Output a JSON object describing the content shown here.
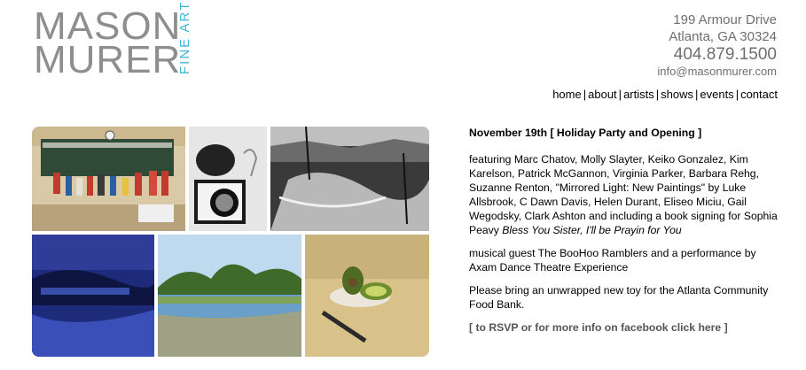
{
  "logo": {
    "line1": "MASON",
    "line2": "MURER",
    "subtitle": "FINE ART"
  },
  "address": {
    "street": "199 Armour Drive",
    "city": "Atlanta, GA 30324",
    "phone": "404.879.1500",
    "email": "info@masonmurer.com"
  },
  "nav": {
    "items": [
      "home",
      "about",
      "artists",
      "shows",
      "events",
      "contact"
    ]
  },
  "event": {
    "date": "November 19th",
    "title": "Holiday Party and Opening",
    "featuring_text": "featuring Marc Chatov, Molly Slayter, Keiko Gonzalez, Kim Karelson, Patrick McGannon, Virginia Parker, Barbara Rehg, Suzanne Renton, \"Mirrored Light: New Paintings\" by Luke Allsbrook, C Dawn Davis, Helen Durant, Eliseo Miciu, Gail Wegodsky, Clark Ashton and including a book signing for Sophia Peavy ",
    "book_title": "Bless You Sister, I'll be Prayin for You",
    "music_text": "musical guest The BooHoo Ramblers and a performance by Axam Dance Theatre Experience",
    "toy_text": "Please bring an unwrapped new toy for the Atlanta Community Food Bank.",
    "rsvp_text": "[ to RSVP or for more info on facebook click here ]"
  },
  "colors": {
    "logo_gray": "#8e8e8e",
    "logo_accent": "#3db7d6",
    "address_gray": "#6f6f6f"
  }
}
